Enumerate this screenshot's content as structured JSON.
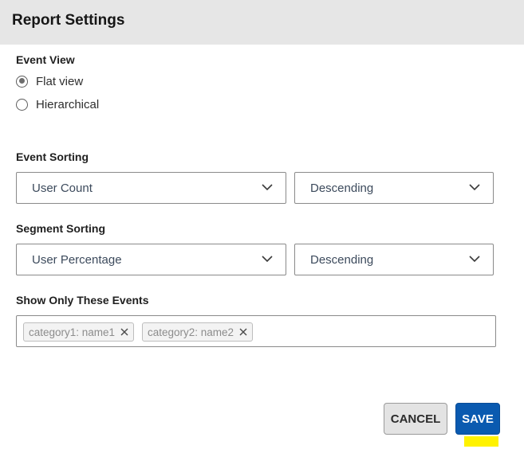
{
  "dialog": {
    "title": "Report Settings"
  },
  "event_view": {
    "label": "Event View",
    "options": [
      {
        "label": "Flat view",
        "checked": true
      },
      {
        "label": "Hierarchical",
        "checked": false
      }
    ]
  },
  "event_sorting": {
    "label": "Event Sorting",
    "field": "User Count",
    "order": "Descending"
  },
  "segment_sorting": {
    "label": "Segment Sorting",
    "field": "User Percentage",
    "order": "Descending"
  },
  "show_only_events": {
    "label": "Show Only These Events",
    "tags": [
      "category1: name1",
      "category2: name2"
    ]
  },
  "actions": {
    "cancel_label": "CANCEL",
    "save_label": "SAVE"
  },
  "colors": {
    "header_bg": "#e6e6e6",
    "primary": "#0a5ab0",
    "focus_highlight": "#fff200"
  },
  "icons": {
    "dropdown": "chevron-down-icon",
    "tag_remove": "close-icon"
  }
}
